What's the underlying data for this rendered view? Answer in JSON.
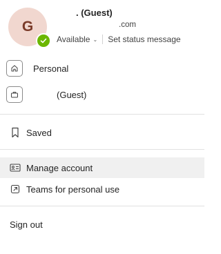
{
  "profile": {
    "initial": "G",
    "name_visible": ". (Guest)",
    "email_visible": ".com",
    "status": "Available",
    "set_status": "Set status message",
    "presence_color": "#6bb700",
    "avatar_bg": "#f1d7cf"
  },
  "accounts": [
    {
      "label": "Personal",
      "icon": "home-icon"
    },
    {
      "label": "(Guest)",
      "icon": "briefcase-icon"
    }
  ],
  "menu": {
    "saved": "Saved",
    "manage_account": "Manage account",
    "teams_personal": "Teams for personal use",
    "sign_out": "Sign out"
  }
}
